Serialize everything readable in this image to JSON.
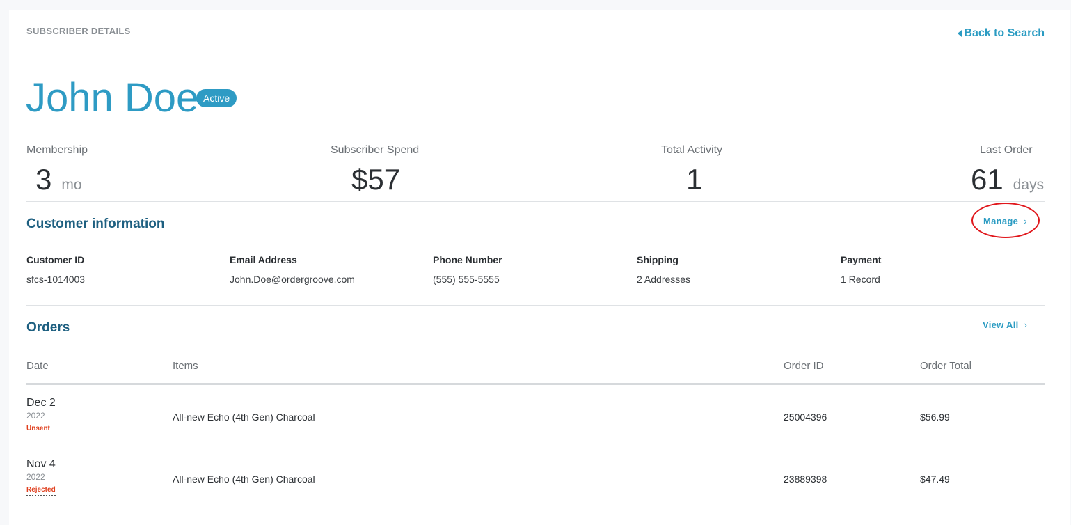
{
  "header": {
    "eyebrow": "SUBSCRIBER DETAILS",
    "back_label": "Back to Search"
  },
  "subscriber": {
    "name": "John Doe",
    "status": "Active"
  },
  "stats": {
    "membership": {
      "label": "Membership",
      "value": "3",
      "unit": "mo"
    },
    "spend": {
      "label": "Subscriber Spend",
      "value": "$57"
    },
    "activity": {
      "label": "Total Activity",
      "value": "1"
    },
    "last_order": {
      "label": "Last Order",
      "value": "61",
      "unit": "days"
    }
  },
  "customer_info": {
    "title": "Customer information",
    "manage_label": "Manage",
    "fields": [
      {
        "label": "Customer ID",
        "value": "sfcs-1014003"
      },
      {
        "label": "Email Address",
        "value": "John.Doe@ordergroove.com"
      },
      {
        "label": "Phone Number",
        "value": "(555) 555-5555"
      },
      {
        "label": "Shipping",
        "value": "2 Addresses"
      },
      {
        "label": "Payment",
        "value": "1 Record"
      }
    ]
  },
  "orders": {
    "title": "Orders",
    "view_all_label": "View All",
    "columns": [
      "Date",
      "Items",
      "Order ID",
      "Order Total"
    ],
    "rows": [
      {
        "date": "Dec 2",
        "year": "2022",
        "status": "Unsent",
        "item": "All-new Echo (4th Gen) Charcoal",
        "order_id": "25004396",
        "total": "$56.99"
      },
      {
        "date": "Nov 4",
        "year": "2022",
        "status": "Rejected",
        "item": "All-new Echo (4th Gen) Charcoal",
        "order_id": "23889398",
        "total": "$47.49"
      }
    ]
  },
  "colors": {
    "accent": "#2e9bc4",
    "section_title": "#1d5f80",
    "status_error": "#e0401f",
    "annotation": "#e0161b"
  },
  "icons": {
    "back": "caret-left-icon",
    "chevron": "chevron-right-icon"
  }
}
